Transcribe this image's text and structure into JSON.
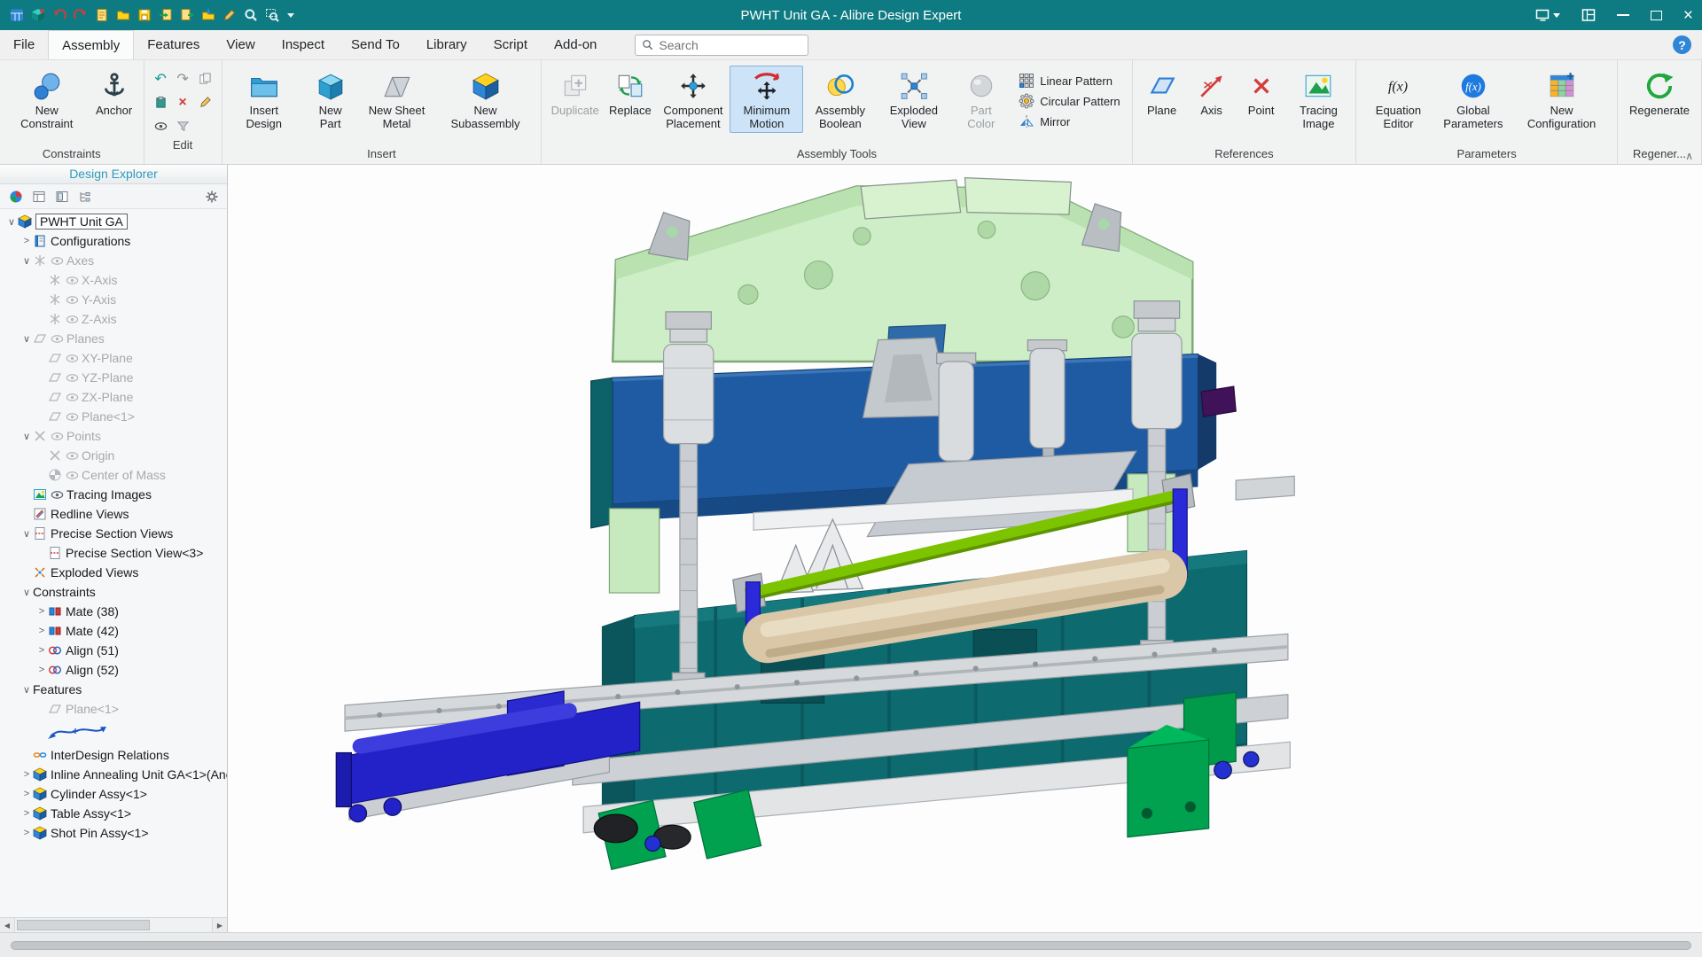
{
  "window": {
    "title": "PWHT Unit GA - Alibre Design Expert",
    "quick_access_icons": [
      "app-grid",
      "new-design",
      "undo",
      "redo",
      "new-document",
      "open",
      "save",
      "import",
      "export",
      "save-as",
      "edit-pencil",
      "zoom",
      "zoom-window",
      "more"
    ],
    "window_control_icons": [
      "display-mode",
      "workspace-layout",
      "minimize",
      "maximize",
      "close"
    ]
  },
  "menu": {
    "items": [
      "File",
      "Assembly",
      "Features",
      "View",
      "Inspect",
      "Send To",
      "Library",
      "Script",
      "Add-on"
    ],
    "active_item": "Assembly",
    "search_placeholder": "Search",
    "help_label": "?"
  },
  "ribbon": {
    "groups": [
      {
        "label": "Constraints"
      },
      {
        "label": "Edit"
      },
      {
        "label": "Insert"
      },
      {
        "label": "Assembly Tools"
      },
      {
        "label": "References"
      },
      {
        "label": "Parameters"
      },
      {
        "label": "Regener..."
      }
    ],
    "buttons": {
      "new_constraint": "New Constraint",
      "anchor": "Anchor",
      "insert_design": "Insert Design",
      "new_part": "New Part",
      "new_sheet_metal": "New Sheet Metal",
      "new_subassembly": "New Subassembly",
      "duplicate": "Duplicate",
      "replace": "Replace",
      "component_placement": "Component Placement",
      "minimum_motion": "Minimum Motion",
      "assembly_boolean": "Assembly Boolean",
      "exploded_view": "Exploded View",
      "part_color": "Part Color",
      "linear_pattern": "Linear Pattern",
      "circular_pattern": "Circular Pattern",
      "mirror": "Mirror",
      "plane": "Plane",
      "axis": "Axis",
      "point": "Point",
      "tracing_image": "Tracing Image",
      "equation_editor": "Equation Editor",
      "global_parameters": "Global Parameters",
      "new_configuration": "New Configuration",
      "regenerate": "Regenerate"
    },
    "selected_button": "Minimum Motion",
    "disabled_buttons": [
      "Duplicate",
      "Part Color"
    ]
  },
  "explorer": {
    "header": "Design Explorer",
    "toolbar_icons": [
      "appearance-sphere",
      "details-panel",
      "preview-panel",
      "structure-panel",
      "settings-gear"
    ],
    "tree": [
      {
        "label": "PWHT Unit GA"
      },
      {
        "label": "Configurations"
      },
      {
        "label": "Axes"
      },
      {
        "label": "X-Axis"
      },
      {
        "label": "Y-Axis"
      },
      {
        "label": "Z-Axis"
      },
      {
        "label": "Planes"
      },
      {
        "label": "XY-Plane"
      },
      {
        "label": "YZ-Plane"
      },
      {
        "label": "ZX-Plane"
      },
      {
        "label": "Plane<1>"
      },
      {
        "label": "Points"
      },
      {
        "label": "Origin"
      },
      {
        "label": "Center of Mass"
      },
      {
        "label": "Tracing Images"
      },
      {
        "label": "Redline Views"
      },
      {
        "label": "Precise Section Views"
      },
      {
        "label": "Precise Section View<3>"
      },
      {
        "label": "Exploded Views"
      },
      {
        "label": "Constraints"
      },
      {
        "label": "Mate (38)"
      },
      {
        "label": "Mate (42)"
      },
      {
        "label": "Align (51)"
      },
      {
        "label": "Align (52)"
      },
      {
        "label": "Features"
      },
      {
        "label": "Plane<1>"
      },
      {
        "label": ""
      },
      {
        "label": "InterDesign Relations"
      },
      {
        "label": "Inline Annealing Unit GA<1>(Anc"
      },
      {
        "label": "Cylinder Assy<1>"
      },
      {
        "label": "Table Assy<1>"
      },
      {
        "label": "Shot Pin Assy<1>"
      }
    ]
  },
  "colors": {
    "titlebar_teal": "#0e7b82",
    "selection_blue": "#cde3f7",
    "frame_green": "#cdeec6",
    "beam_blue": "#1e5ba2",
    "body_teal": "#0d6b6f",
    "machine_green": "#00a14f",
    "arm_blue": "#2222c8",
    "roller_tan": "#d9c7a7",
    "bar_lime": "#7cc400"
  }
}
